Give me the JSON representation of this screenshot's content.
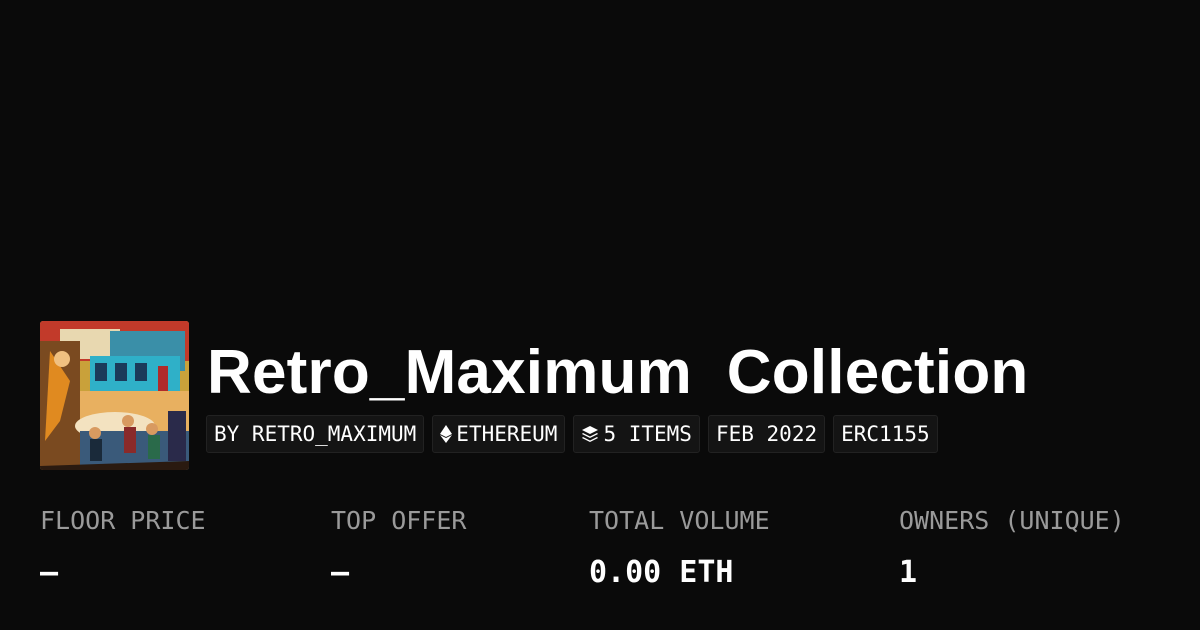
{
  "collection": {
    "title": "Retro_Maximum  Collection",
    "avatar_icon": "collection-artwork",
    "tags": [
      {
        "label": "BY RETRO_MAXIMUM",
        "icon": ""
      },
      {
        "label": "ETHEREUM",
        "icon": "ethereum-icon"
      },
      {
        "label": "5 ITEMS",
        "icon": "layers-icon"
      },
      {
        "label": "FEB 2022",
        "icon": ""
      },
      {
        "label": "ERC1155",
        "icon": ""
      }
    ]
  },
  "stats": [
    {
      "label": "FLOOR PRICE",
      "value": "–"
    },
    {
      "label": "TOP OFFER",
      "value": "–"
    },
    {
      "label": "TOTAL VOLUME",
      "value": "0.00 ETH"
    },
    {
      "label": "OWNERS (UNIQUE)",
      "value": "1"
    }
  ],
  "colors": {
    "background": "#0a0a0a",
    "tag_background": "#141414",
    "tag_border": "#222222",
    "label_text": "#9a9a9a",
    "value_text": "#ffffff"
  }
}
